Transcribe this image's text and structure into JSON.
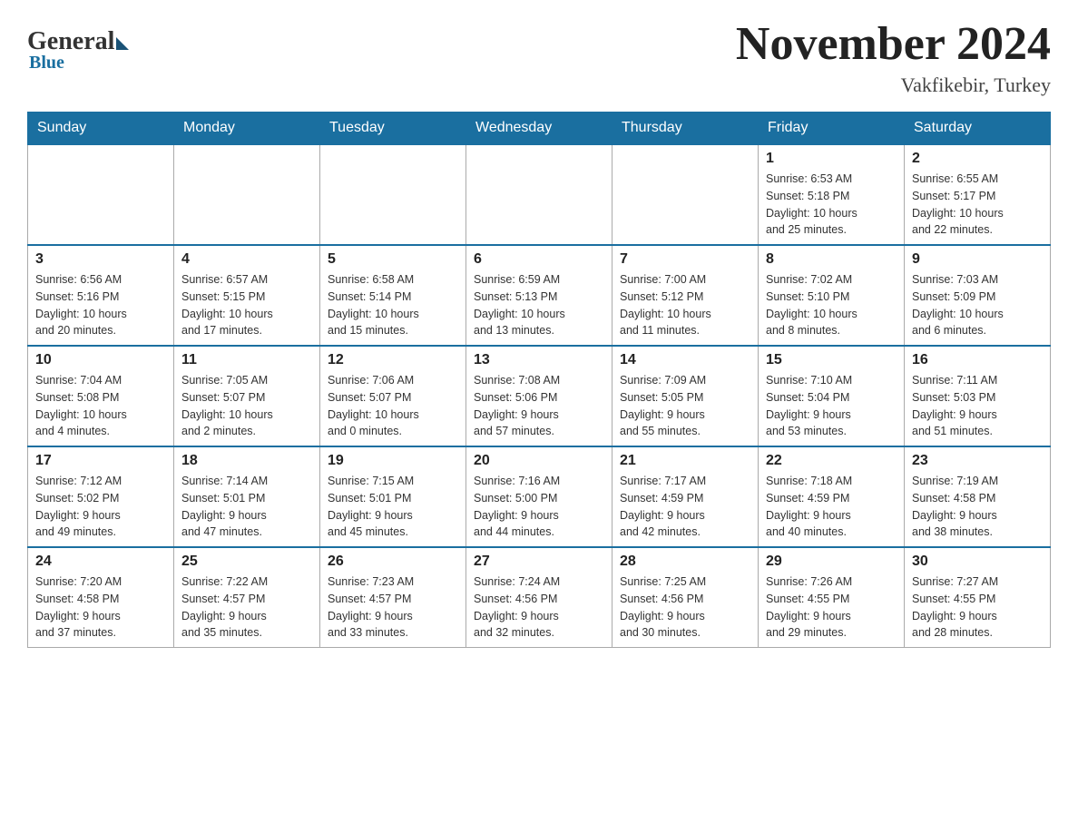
{
  "header": {
    "logo_general": "General",
    "logo_blue": "Blue",
    "month_title": "November 2024",
    "location": "Vakfikebir, Turkey"
  },
  "weekdays": [
    "Sunday",
    "Monday",
    "Tuesday",
    "Wednesday",
    "Thursday",
    "Friday",
    "Saturday"
  ],
  "weeks": [
    [
      {
        "day": "",
        "info": ""
      },
      {
        "day": "",
        "info": ""
      },
      {
        "day": "",
        "info": ""
      },
      {
        "day": "",
        "info": ""
      },
      {
        "day": "",
        "info": ""
      },
      {
        "day": "1",
        "info": "Sunrise: 6:53 AM\nSunset: 5:18 PM\nDaylight: 10 hours\nand 25 minutes."
      },
      {
        "day": "2",
        "info": "Sunrise: 6:55 AM\nSunset: 5:17 PM\nDaylight: 10 hours\nand 22 minutes."
      }
    ],
    [
      {
        "day": "3",
        "info": "Sunrise: 6:56 AM\nSunset: 5:16 PM\nDaylight: 10 hours\nand 20 minutes."
      },
      {
        "day": "4",
        "info": "Sunrise: 6:57 AM\nSunset: 5:15 PM\nDaylight: 10 hours\nand 17 minutes."
      },
      {
        "day": "5",
        "info": "Sunrise: 6:58 AM\nSunset: 5:14 PM\nDaylight: 10 hours\nand 15 minutes."
      },
      {
        "day": "6",
        "info": "Sunrise: 6:59 AM\nSunset: 5:13 PM\nDaylight: 10 hours\nand 13 minutes."
      },
      {
        "day": "7",
        "info": "Sunrise: 7:00 AM\nSunset: 5:12 PM\nDaylight: 10 hours\nand 11 minutes."
      },
      {
        "day": "8",
        "info": "Sunrise: 7:02 AM\nSunset: 5:10 PM\nDaylight: 10 hours\nand 8 minutes."
      },
      {
        "day": "9",
        "info": "Sunrise: 7:03 AM\nSunset: 5:09 PM\nDaylight: 10 hours\nand 6 minutes."
      }
    ],
    [
      {
        "day": "10",
        "info": "Sunrise: 7:04 AM\nSunset: 5:08 PM\nDaylight: 10 hours\nand 4 minutes."
      },
      {
        "day": "11",
        "info": "Sunrise: 7:05 AM\nSunset: 5:07 PM\nDaylight: 10 hours\nand 2 minutes."
      },
      {
        "day": "12",
        "info": "Sunrise: 7:06 AM\nSunset: 5:07 PM\nDaylight: 10 hours\nand 0 minutes."
      },
      {
        "day": "13",
        "info": "Sunrise: 7:08 AM\nSunset: 5:06 PM\nDaylight: 9 hours\nand 57 minutes."
      },
      {
        "day": "14",
        "info": "Sunrise: 7:09 AM\nSunset: 5:05 PM\nDaylight: 9 hours\nand 55 minutes."
      },
      {
        "day": "15",
        "info": "Sunrise: 7:10 AM\nSunset: 5:04 PM\nDaylight: 9 hours\nand 53 minutes."
      },
      {
        "day": "16",
        "info": "Sunrise: 7:11 AM\nSunset: 5:03 PM\nDaylight: 9 hours\nand 51 minutes."
      }
    ],
    [
      {
        "day": "17",
        "info": "Sunrise: 7:12 AM\nSunset: 5:02 PM\nDaylight: 9 hours\nand 49 minutes."
      },
      {
        "day": "18",
        "info": "Sunrise: 7:14 AM\nSunset: 5:01 PM\nDaylight: 9 hours\nand 47 minutes."
      },
      {
        "day": "19",
        "info": "Sunrise: 7:15 AM\nSunset: 5:01 PM\nDaylight: 9 hours\nand 45 minutes."
      },
      {
        "day": "20",
        "info": "Sunrise: 7:16 AM\nSunset: 5:00 PM\nDaylight: 9 hours\nand 44 minutes."
      },
      {
        "day": "21",
        "info": "Sunrise: 7:17 AM\nSunset: 4:59 PM\nDaylight: 9 hours\nand 42 minutes."
      },
      {
        "day": "22",
        "info": "Sunrise: 7:18 AM\nSunset: 4:59 PM\nDaylight: 9 hours\nand 40 minutes."
      },
      {
        "day": "23",
        "info": "Sunrise: 7:19 AM\nSunset: 4:58 PM\nDaylight: 9 hours\nand 38 minutes."
      }
    ],
    [
      {
        "day": "24",
        "info": "Sunrise: 7:20 AM\nSunset: 4:58 PM\nDaylight: 9 hours\nand 37 minutes."
      },
      {
        "day": "25",
        "info": "Sunrise: 7:22 AM\nSunset: 4:57 PM\nDaylight: 9 hours\nand 35 minutes."
      },
      {
        "day": "26",
        "info": "Sunrise: 7:23 AM\nSunset: 4:57 PM\nDaylight: 9 hours\nand 33 minutes."
      },
      {
        "day": "27",
        "info": "Sunrise: 7:24 AM\nSunset: 4:56 PM\nDaylight: 9 hours\nand 32 minutes."
      },
      {
        "day": "28",
        "info": "Sunrise: 7:25 AM\nSunset: 4:56 PM\nDaylight: 9 hours\nand 30 minutes."
      },
      {
        "day": "29",
        "info": "Sunrise: 7:26 AM\nSunset: 4:55 PM\nDaylight: 9 hours\nand 29 minutes."
      },
      {
        "day": "30",
        "info": "Sunrise: 7:27 AM\nSunset: 4:55 PM\nDaylight: 9 hours\nand 28 minutes."
      }
    ]
  ]
}
